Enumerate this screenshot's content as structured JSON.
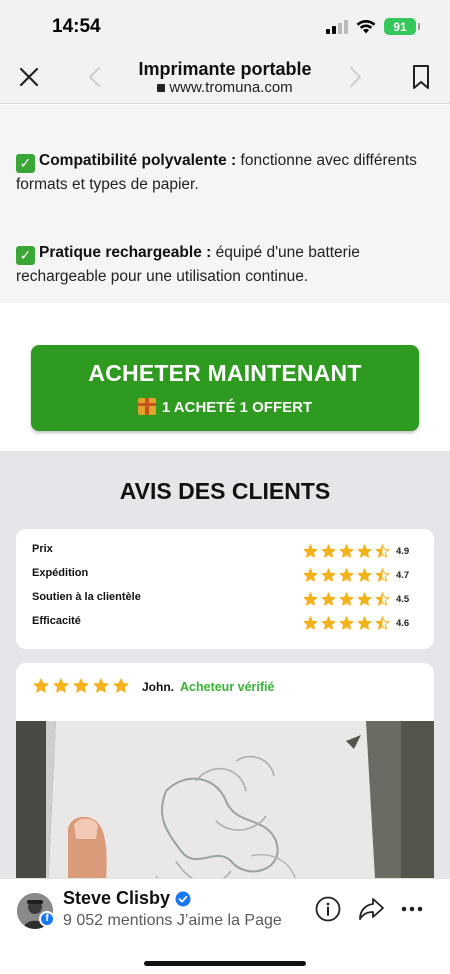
{
  "status_bar": {
    "time": "14:54",
    "battery": "91"
  },
  "browser": {
    "title": "Imprimante portable",
    "url": "www.tromuna.com"
  },
  "features": [
    {
      "bold": "Compatibilité polyvalente :",
      "text": " fonctionne avec différents formats et types de papier."
    },
    {
      "bold": "Pratique rechargeable :",
      "text": " équipé d'une batterie rechargeable pour une utilisation continue."
    }
  ],
  "cta": {
    "title": "ACHETER MAINTENANT",
    "subtitle": "1 ACHETÉ 1 OFFERT"
  },
  "reviews": {
    "title": "AVIS DES CLIENTS",
    "ratings": [
      {
        "label": "Prix",
        "value": "4.9",
        "stars": 4.5
      },
      {
        "label": "Expédition",
        "value": "4.7",
        "stars": 4.5
      },
      {
        "label": "Soutien à la clientèle",
        "value": "4.5",
        "stars": 4.5
      },
      {
        "label": "Efficacité",
        "value": "4.6",
        "stars": 4.5
      }
    ],
    "review": {
      "author": "John.",
      "verified": "Acheteur vérifié",
      "stars": 5
    }
  },
  "facebook": {
    "page_name": "Steve Clisby",
    "likes": "9 052 mentions J’aime la Page"
  },
  "colors": {
    "accent_green": "#2e9a1f",
    "verified_green": "#36b432",
    "star": "#f6b21b",
    "facebook_blue": "#1877f2"
  },
  "icons": [
    "close-icon",
    "back-arrow-icon",
    "forward-arrow-icon",
    "bookmark-icon",
    "lock-icon",
    "checkmark-icon",
    "gift-icon",
    "star-icon",
    "half-star-icon",
    "verified-badge-icon",
    "facebook-icon",
    "info-icon",
    "share-icon",
    "more-icon"
  ]
}
